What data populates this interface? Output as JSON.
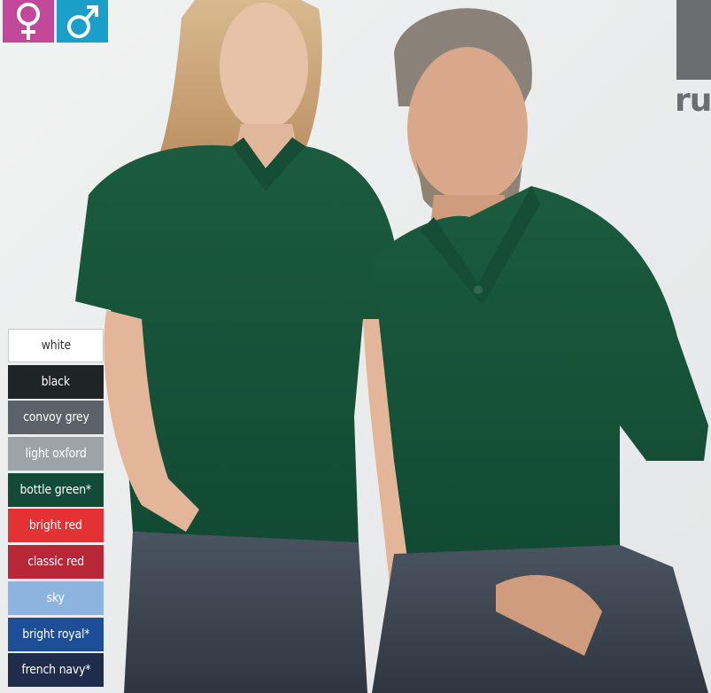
{
  "gender_badges": [
    {
      "name": "female",
      "color": "#c2489a",
      "icon": "female-symbol-icon"
    },
    {
      "name": "male",
      "color": "#1aa0c8",
      "icon": "male-symbol-icon"
    }
  ],
  "brand": {
    "text": "ru",
    "color": "#6b6e70"
  },
  "swatches": [
    {
      "label": "white",
      "color": "#ffffff"
    },
    {
      "label": "black",
      "color": "#1f2426"
    },
    {
      "label": "convoy grey",
      "color": "#5c6269"
    },
    {
      "label": "light oxford",
      "color": "#9ea3a7"
    },
    {
      "label": "bottle green*",
      "color": "#124b38"
    },
    {
      "label": "bright red",
      "color": "#e43234"
    },
    {
      "label": "classic red",
      "color": "#b82738"
    },
    {
      "label": "sky",
      "color": "#8db4de"
    },
    {
      "label": "bright royal*",
      "color": "#1d4f98"
    },
    {
      "label": "french navy*",
      "color": "#202c4c"
    }
  ]
}
